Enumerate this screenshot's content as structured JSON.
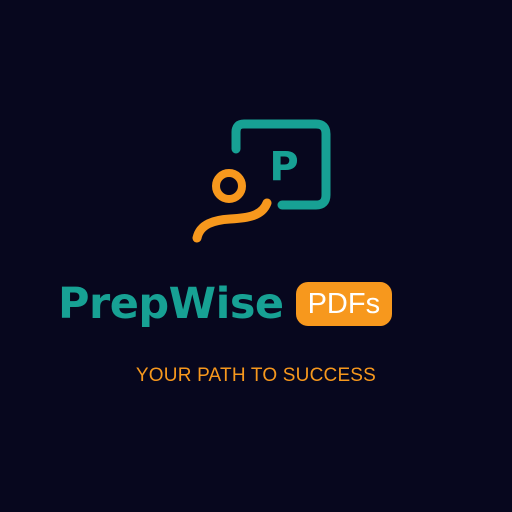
{
  "logo": {
    "icon": "person-path-p-icon",
    "icon_letter": "P",
    "brand_name": "PrepWise",
    "badge_text": "PDFs",
    "tagline": "YOUR PATH TO SUCCESS"
  },
  "colors": {
    "background": "#07071e",
    "teal": "#17a194",
    "orange": "#f7981d",
    "badge_text": "#ffffff"
  }
}
